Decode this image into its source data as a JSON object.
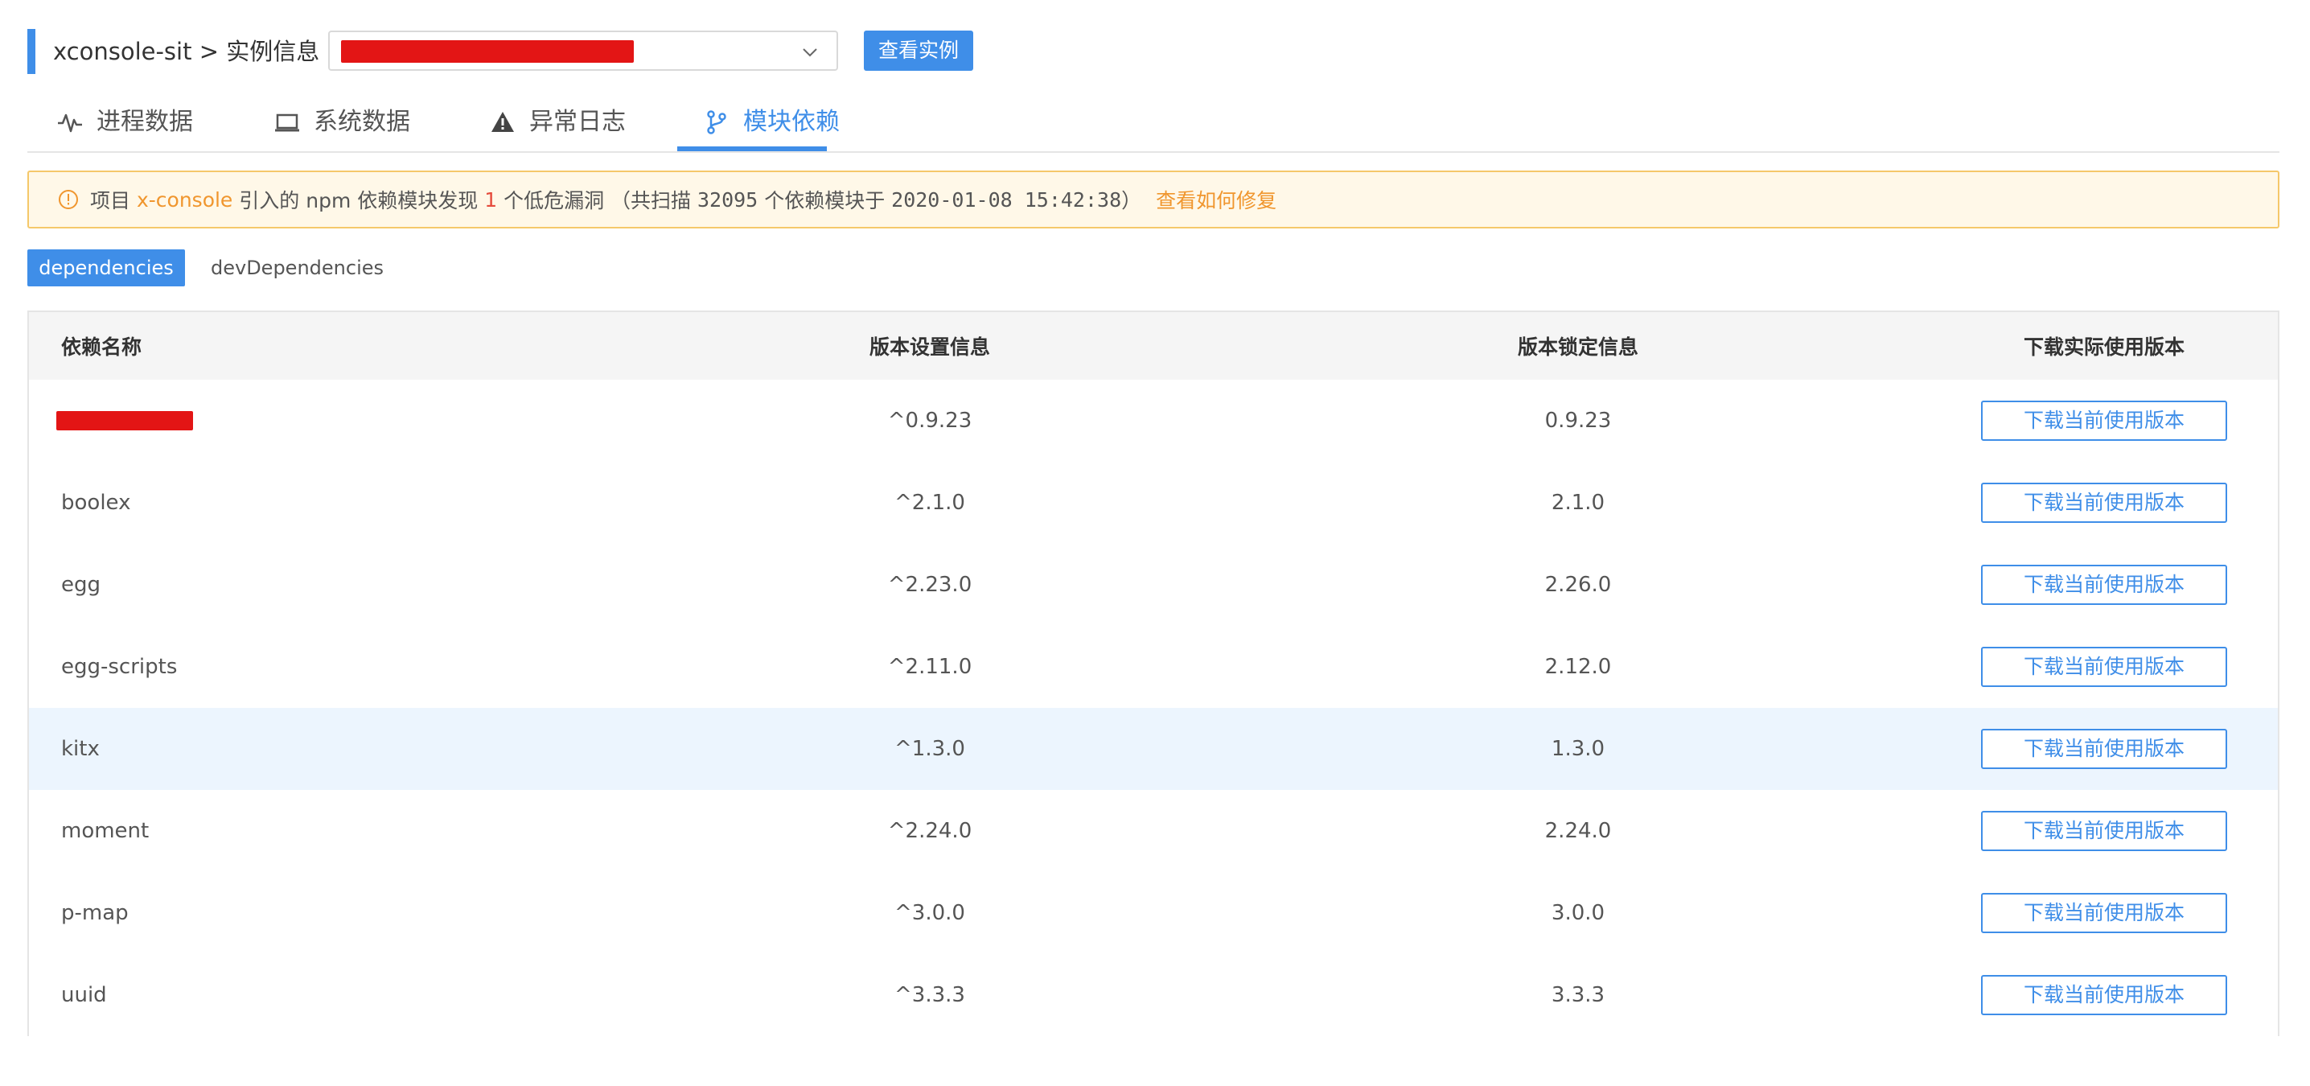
{
  "header": {
    "breadcrumb": "xconsole-sit > 实例信息",
    "view_button": "查看实例",
    "accent_color": "#3f8ee8"
  },
  "tabs": [
    {
      "label": "进程数据",
      "icon": "pulse-icon"
    },
    {
      "label": "系统数据",
      "icon": "laptop-icon"
    },
    {
      "label": "异常日志",
      "icon": "warning-icon"
    },
    {
      "label": "模块依赖",
      "icon": "branch-icon",
      "active": true
    }
  ],
  "alert": {
    "prefix": "项目",
    "project": "x-console",
    "text1": "引入的 npm 依赖模块发现",
    "count": "1",
    "text2": "个低危漏洞 （共扫描",
    "scanned": "32095",
    "text3": "个依赖模块于",
    "datetime": "2020-01-08 15:42:38",
    "text4": "）",
    "link": "查看如何修复"
  },
  "subtabs": {
    "dependencies": "dependencies",
    "devDependencies": "devDependencies"
  },
  "table": {
    "headers": [
      "依赖名称",
      "版本设置信息",
      "版本锁定信息",
      "下载实际使用版本"
    ],
    "download_label": "下载当前使用版本",
    "rows": [
      {
        "name": "",
        "redacted": true,
        "range": "^0.9.23",
        "locked": "0.9.23"
      },
      {
        "name": "boolex",
        "range": "^2.1.0",
        "locked": "2.1.0"
      },
      {
        "name": "egg",
        "range": "^2.23.0",
        "locked": "2.26.0"
      },
      {
        "name": "egg-scripts",
        "range": "^2.11.0",
        "locked": "2.12.0"
      },
      {
        "name": "kitx",
        "range": "^1.3.0",
        "locked": "1.3.0"
      },
      {
        "name": "moment",
        "range": "^2.24.0",
        "locked": "2.24.0"
      },
      {
        "name": "p-map",
        "range": "^3.0.0",
        "locked": "3.0.0"
      },
      {
        "name": "uuid",
        "range": "^3.3.3",
        "locked": "3.3.3"
      }
    ]
  }
}
